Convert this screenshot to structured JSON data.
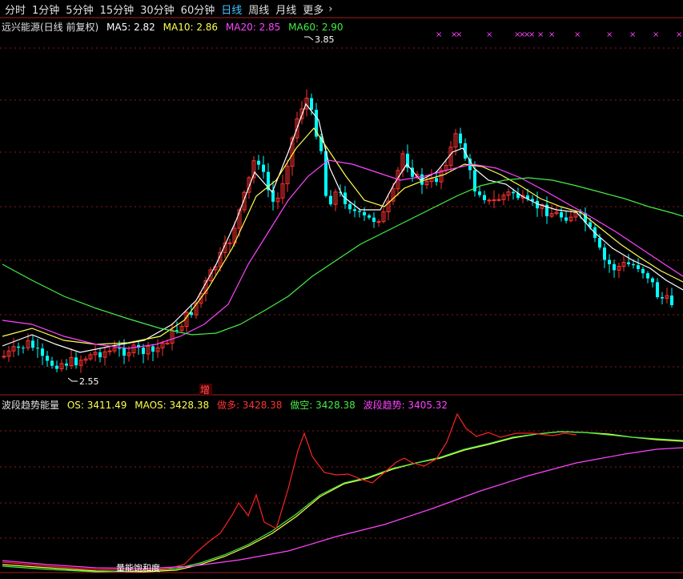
{
  "toolbar": {
    "periods": [
      "分时",
      "1分钟",
      "5分钟",
      "15分钟",
      "30分钟",
      "60分钟",
      "日线",
      "周线",
      "月线",
      "更多"
    ],
    "active": "日线"
  },
  "main_panel": {
    "stock_title": "远兴能源(日线 前复权)",
    "ma": [
      {
        "label": "MA5: 2.82",
        "color": "#ffffff"
      },
      {
        "label": "MA10: 2.86",
        "color": "#ffff4d"
      },
      {
        "label": "MA20: 2.85",
        "color": "#ff44ff"
      },
      {
        "label": "MA60: 2.90",
        "color": "#44ee44"
      }
    ],
    "high_label": "3.85",
    "low_label": "2.55",
    "marker_label": "增"
  },
  "indicator_panel": {
    "title": "波段趋势能量",
    "items": [
      {
        "label": "OS: 3411.49",
        "color": "#ffff4d"
      },
      {
        "label": "MAOS: 3428.38",
        "color": "#ffff4d"
      },
      {
        "label": "做多: 3428.38",
        "color": "#ff3333"
      },
      {
        "label": "做空: 3428.38",
        "color": "#44ee44"
      },
      {
        "label": "波段趋势: 3405.32",
        "color": "#ff44ff"
      }
    ],
    "bottom_text": "量能饱和度"
  },
  "chart_data": [
    {
      "type": "candlestick",
      "title": "远兴能源(日线 前复权)",
      "annotations": [
        "3.85 (high)",
        "2.55 (low)"
      ],
      "series": [
        {
          "name": "MA5",
          "value": 2.82
        },
        {
          "name": "MA10",
          "value": 2.86
        },
        {
          "name": "MA20",
          "value": 2.85
        },
        {
          "name": "MA60",
          "value": 2.9
        }
      ]
    },
    {
      "type": "line",
      "title": "波段趋势能量",
      "series": [
        {
          "name": "OS",
          "value": 3411.49
        },
        {
          "name": "MAOS",
          "value": 3428.38
        },
        {
          "name": "做多",
          "value": 3428.38
        },
        {
          "name": "做空",
          "value": 3428.38
        },
        {
          "name": "波段趋势",
          "value": 3405.32
        }
      ]
    }
  ],
  "colors": {
    "up": "#ff3232",
    "down": "#00ffff",
    "grid": "#8b1a1a",
    "bg": "#000000"
  }
}
